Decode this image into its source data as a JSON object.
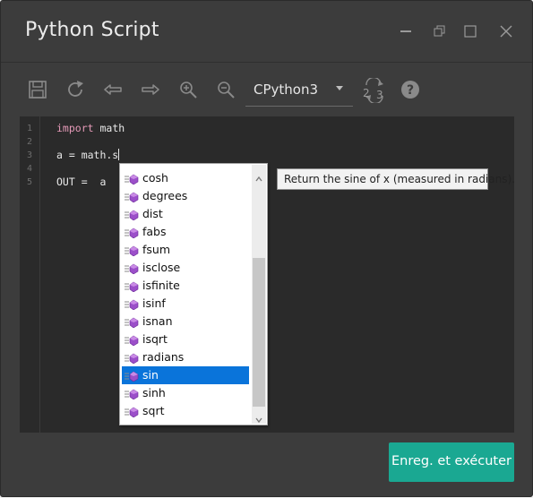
{
  "window": {
    "title": "Python Script",
    "controls": [
      "minimize-icon",
      "restore-icon",
      "maximize-icon",
      "close-icon"
    ]
  },
  "toolbar": {
    "icons": [
      "save-icon",
      "refresh-icon",
      "undo-icon",
      "redo-icon",
      "zoom-in-icon",
      "zoom-out-icon",
      "convert-python-icon",
      "help-icon"
    ],
    "engine_label": "CPython3",
    "convert_badge_from": "2",
    "convert_badge_to": "3",
    "help_label": "?"
  },
  "editor": {
    "line_numbers": [
      "1",
      "2",
      "3",
      "4",
      "5"
    ],
    "line1_keyword": "import",
    "line1_rest": " math",
    "line3": "a = math.s",
    "line5": "OUT =  a"
  },
  "autocomplete": {
    "items": [
      "cosh",
      "degrees",
      "dist",
      "fabs",
      "fsum",
      "isclose",
      "isfinite",
      "isinf",
      "isnan",
      "isqrt",
      "radians",
      "sin",
      "sinh",
      "sqrt"
    ],
    "selected": "sin"
  },
  "tooltip": {
    "text": "Return the sine of x (measured in radians)."
  },
  "footer": {
    "run_label": "Enreg. et exécuter"
  },
  "colors": {
    "window_bg": "#3c3c3c",
    "editor_bg": "#2a2a2a",
    "keyword": "#e59ab8",
    "selection": "#0a74da",
    "run_button": "#1aa892"
  }
}
